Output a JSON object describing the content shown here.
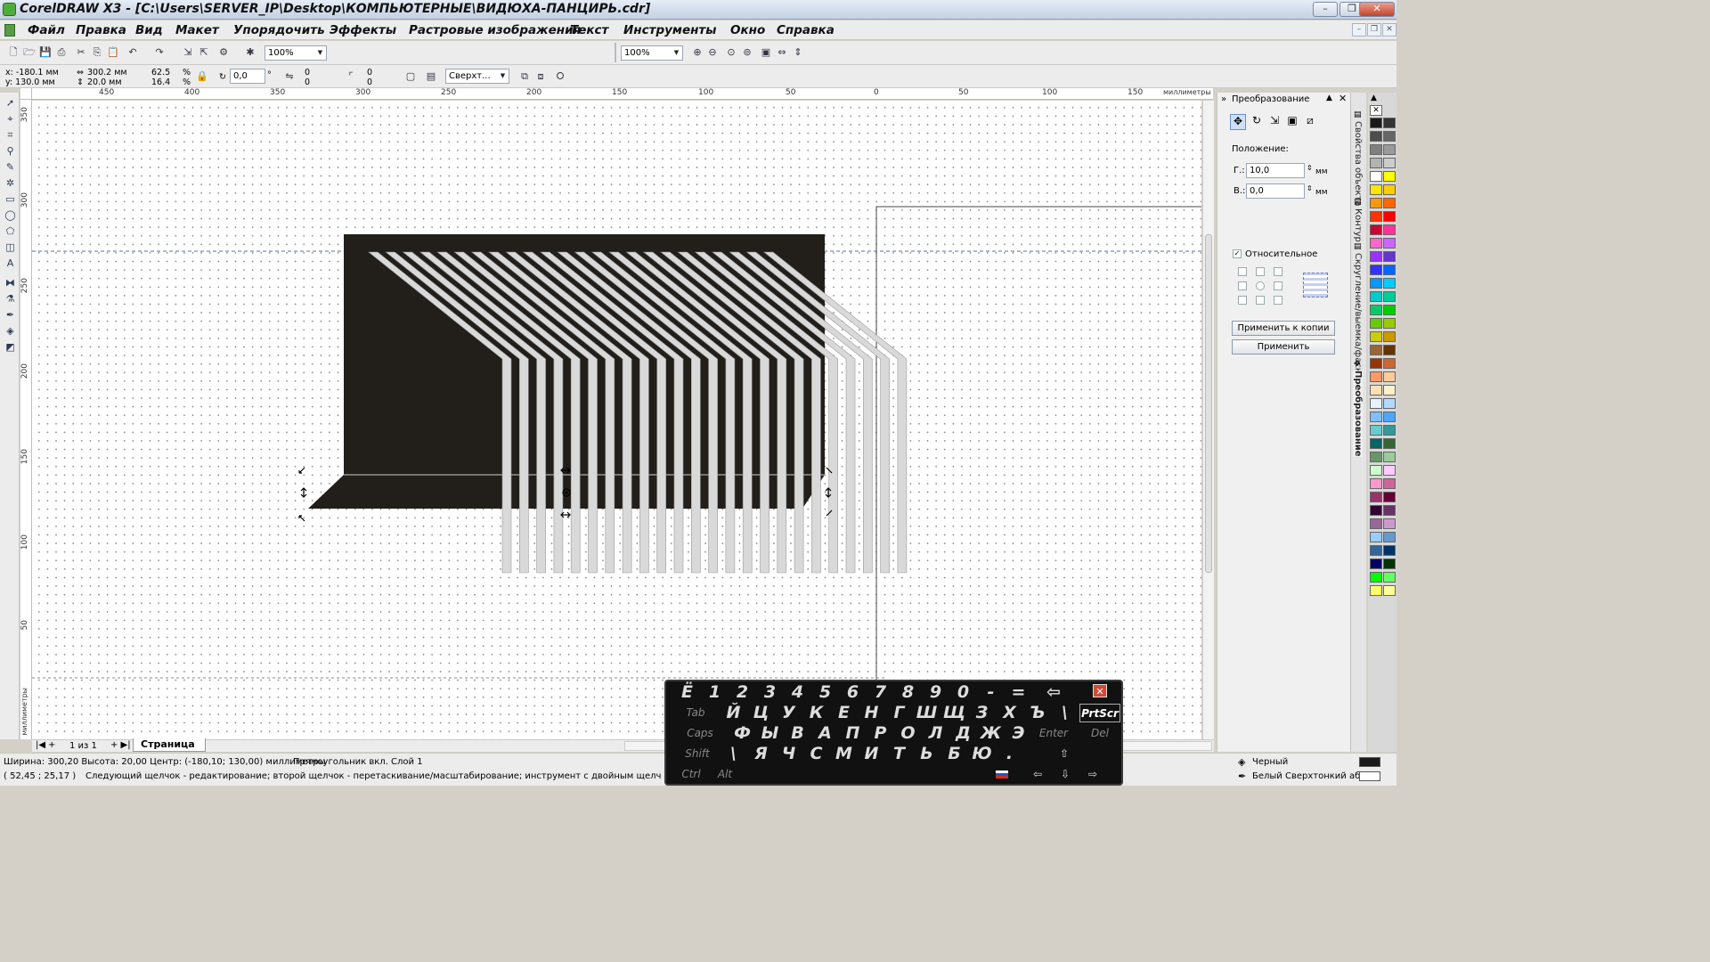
{
  "window": {
    "title": "CorelDRAW X3 - [C:\\Users\\SERVER_IP\\Desktop\\КОМПЬЮТЕРНЫЕ\\ВИДЮХА-ПАНЦИРЬ.cdr]",
    "min": "–",
    "max": "❐",
    "close": "✕"
  },
  "menu": [
    "Файл",
    "Правка",
    "Вид",
    "Макет",
    "Упорядочить",
    "Эффекты",
    "Растровые изображения",
    "Текст",
    "Инструменты",
    "Окно",
    "Справка"
  ],
  "mdi": {
    "min": "–",
    "restore": "❐",
    "close": "✕"
  },
  "standard": {
    "zoom": "100%",
    "zoom2": "100%"
  },
  "property": {
    "x": "x: -180.1 мм",
    "y": "y: 130.0 мм",
    "w": "300.2 мм",
    "h": "20.0 мм",
    "sx": "62.5",
    "sy": "16.4",
    "pct": "%",
    "pct2": "%",
    "angle": "0,0",
    "deg": "°",
    "c1": "0",
    "c2": "0",
    "c3": "0",
    "c4": "0",
    "wrap": "Сверхт..."
  },
  "ruler": {
    "h": [
      "450",
      "400",
      "350",
      "300",
      "250",
      "200",
      "150",
      "100",
      "50",
      "0",
      "50",
      "100",
      "150"
    ],
    "units": "миллиметры",
    "v": [
      "350",
      "300",
      "250",
      "200",
      "150",
      "100",
      "50"
    ],
    "vunits": "миллиметры"
  },
  "docker": {
    "title": "Преобразование",
    "position": "Положение:",
    "h_label": "Г.:",
    "h_val": "10,0",
    "v_label": "В.:",
    "v_val": "0,0",
    "unit": "мм",
    "relative": "Относительное",
    "apply_copy": "Применить к копии",
    "apply": "Применить"
  },
  "docker_tabs": [
    "Свойства объекта",
    "Контур",
    "Скругление/выемка/фаска",
    "Преобразование"
  ],
  "palette": [
    "#1a1a1a",
    "#333333",
    "#4d4d4d",
    "#666666",
    "#808080",
    "#999999",
    "#b3b3b3",
    "#cccccc",
    "#ffffff",
    "#ffff00",
    "#ffe600",
    "#ffcc00",
    "#ff9900",
    "#ff6600",
    "#ff3300",
    "#ff0000",
    "#cc0033",
    "#ff3399",
    "#ff66cc",
    "#cc66ff",
    "#9933ff",
    "#6633cc",
    "#3333ff",
    "#0066ff",
    "#0099ff",
    "#00ccff",
    "#00cccc",
    "#00cc99",
    "#00cc66",
    "#00cc00",
    "#66cc00",
    "#99cc00",
    "#cccc00",
    "#cc9900",
    "#996633",
    "#663300",
    "#993300",
    "#cc6633",
    "#ff9966",
    "#ffcc99",
    "#ffe0b3",
    "#fff0cc",
    "#e6f2ff",
    "#b3d9ff",
    "#80bfff",
    "#4da6ff",
    "#66cccc",
    "#339999",
    "#006666",
    "#336633",
    "#669966",
    "#99cc99",
    "#ccffcc",
    "#ffccff",
    "#ff99cc",
    "#cc6699",
    "#993366",
    "#660033",
    "#330033",
    "#663366",
    "#996699",
    "#cc99cc",
    "#99ccff",
    "#6699cc",
    "#336699",
    "#003366",
    "#000066",
    "#003300",
    "#00ff00",
    "#66ff66",
    "#ffff66",
    "#ffff99"
  ],
  "pages": {
    "count": "1 из 1",
    "tab": "Страница 1"
  },
  "status": {
    "size": "Ширина: 300,20  Высота: 20,00  Центр: (-180,10; 130,00)  миллиметры",
    "obj": "Прямоугольник вкл. Слой 1",
    "coords": "( 52,45 ; 25,17 )",
    "hint": "Следующий щелчок - редактирование; второй щелчок - перетаскивание/масштабирование; инструмент с двойным щелчком выбирает в...",
    "fill": "Черный",
    "outline": "Белый  Сверхтонкий абрис"
  },
  "osk": {
    "row1": [
      "Ё",
      "1",
      "2",
      "3",
      "4",
      "5",
      "6",
      "7",
      "8",
      "9",
      "0",
      "-",
      "=",
      "⇦"
    ],
    "row2": [
      "Tab",
      "Й",
      "Ц",
      "У",
      "К",
      "Е",
      "Н",
      "Г",
      "Ш",
      "Щ",
      "З",
      "Х",
      "Ъ",
      "\\",
      "PrtScr"
    ],
    "row3": [
      "Caps",
      "Ф",
      "Ы",
      "В",
      "А",
      "П",
      "Р",
      "О",
      "Л",
      "Д",
      "Ж",
      "Э",
      "Enter",
      "Del"
    ],
    "row4": [
      "Shift",
      "\\",
      "Я",
      "Ч",
      "С",
      "М",
      "И",
      "Т",
      "Ь",
      "Б",
      "Ю",
      ".",
      "⇧"
    ],
    "row5": [
      "Ctrl",
      "Alt",
      "⇦",
      "⇩",
      "⇨"
    ],
    "close": "✕"
  }
}
